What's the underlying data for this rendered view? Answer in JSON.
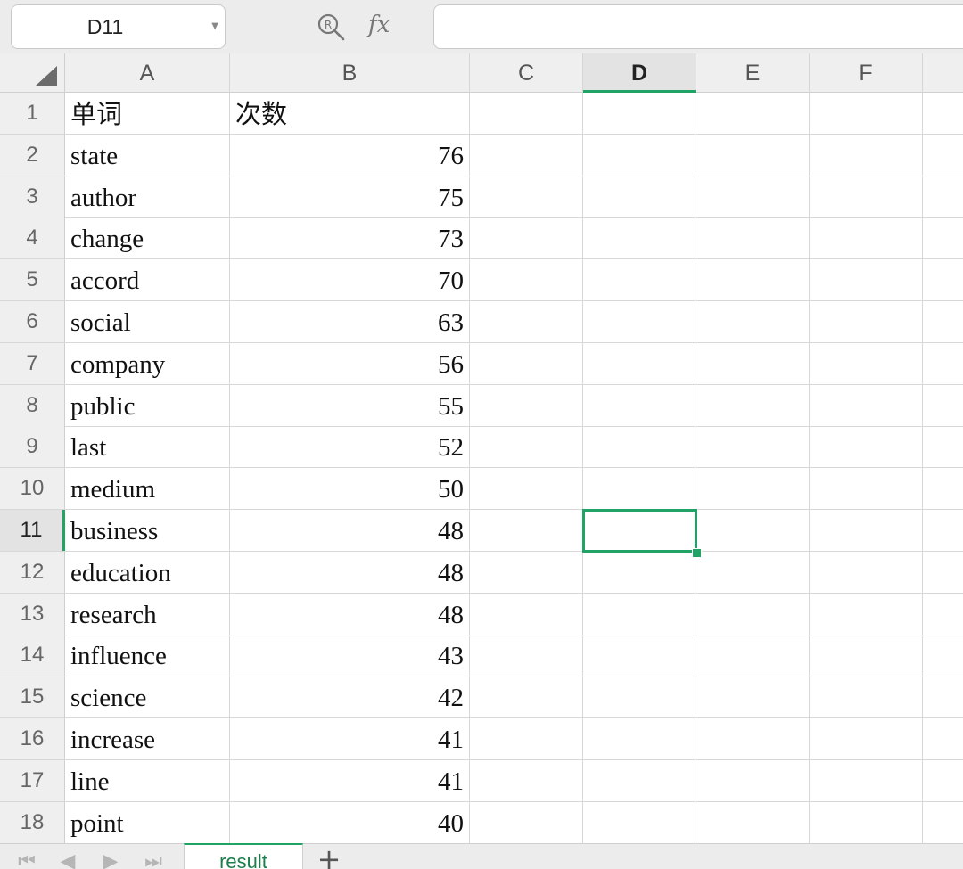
{
  "formula_bar": {
    "name_box": "D11",
    "fx_label": "fx",
    "formula_value": ""
  },
  "columns": [
    "A",
    "B",
    "C",
    "D",
    "E",
    "F"
  ],
  "active_column": "D",
  "active_row": "11",
  "header_row": {
    "row": "1",
    "a": "单词",
    "b": "次数"
  },
  "rows": [
    {
      "row": "2",
      "word": "state",
      "count": "76"
    },
    {
      "row": "3",
      "word": "author",
      "count": "75"
    },
    {
      "row": "4",
      "word": "change",
      "count": "73"
    },
    {
      "row": "5",
      "word": "accord",
      "count": "70"
    },
    {
      "row": "6",
      "word": "social",
      "count": "63"
    },
    {
      "row": "7",
      "word": "company",
      "count": "56"
    },
    {
      "row": "8",
      "word": "public",
      "count": "55"
    },
    {
      "row": "9",
      "word": "last",
      "count": "52"
    },
    {
      "row": "10",
      "word": "medium",
      "count": "50"
    },
    {
      "row": "11",
      "word": "business",
      "count": "48"
    },
    {
      "row": "12",
      "word": "education",
      "count": "48"
    },
    {
      "row": "13",
      "word": "research",
      "count": "48"
    },
    {
      "row": "14",
      "word": "influence",
      "count": "43"
    },
    {
      "row": "15",
      "word": "science",
      "count": "42"
    },
    {
      "row": "16",
      "word": "increase",
      "count": "41"
    },
    {
      "row": "17",
      "word": "line",
      "count": "41"
    },
    {
      "row": "18",
      "word": "point",
      "count": "40"
    }
  ],
  "sheet_tabs": {
    "active": "result",
    "add": "+"
  },
  "icons": {
    "zoom": "zoom-formula-icon",
    "first_sheet": "first-sheet-icon",
    "prev_sheet": "prev-sheet-icon",
    "next_sheet": "next-sheet-icon",
    "last_sheet": "last-sheet-icon"
  },
  "colors": {
    "accent": "#21a366"
  }
}
